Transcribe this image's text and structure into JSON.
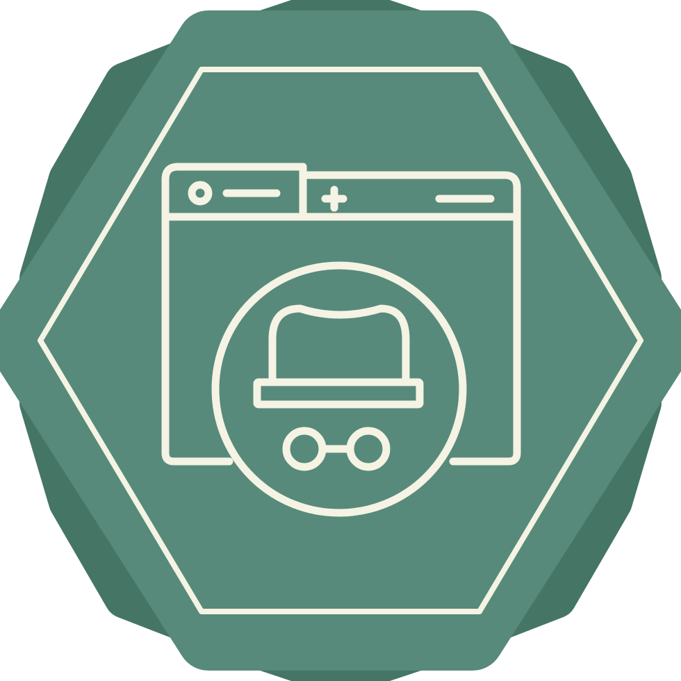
{
  "icon": {
    "name": "incognito-browser-icon",
    "badge_shape": "octagonal-star-badge",
    "symbol": "browser-window-with-incognito-hat-and-glasses"
  },
  "colors": {
    "background": "#ffffff",
    "badge_back": "#457565",
    "badge_front": "#578a7b",
    "line": "#f5f3e4"
  }
}
